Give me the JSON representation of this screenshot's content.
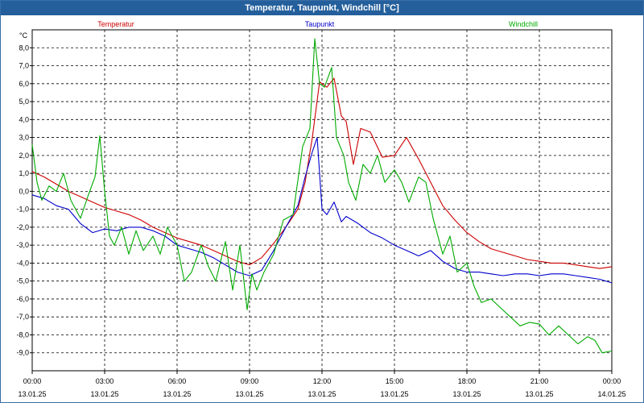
{
  "window": {
    "title": "Temperatur, Taupunkt, Windchill [°C]"
  },
  "chart_data": {
    "type": "line",
    "title": "Temperatur, Taupunkt, Windchill [°C]",
    "ylabel": "°C",
    "ylim": [
      -10,
      9
    ],
    "yticks": [
      "8,0",
      "7,0",
      "6,0",
      "5,0",
      "4,0",
      "3,0",
      "2,0",
      "1,0",
      "0,0",
      "-1,0",
      "-2,0",
      "-3,0",
      "-4,0",
      "-5,0",
      "-6,0",
      "-7,0",
      "-8,0",
      "-9,0"
    ],
    "ytick_values": [
      8,
      7,
      6,
      5,
      4,
      3,
      2,
      1,
      0,
      -1,
      -2,
      -3,
      -4,
      -5,
      -6,
      -7,
      -8,
      -9
    ],
    "xlim": [
      0,
      24
    ],
    "xticks": [
      {
        "time": "00:00",
        "date": "13.01.25",
        "x": 0
      },
      {
        "time": "03:00",
        "date": "13.01.25",
        "x": 3
      },
      {
        "time": "06:00",
        "date": "13.01.25",
        "x": 6
      },
      {
        "time": "09:00",
        "date": "13.01.25",
        "x": 9
      },
      {
        "time": "12:00",
        "date": "13.01.25",
        "x": 12
      },
      {
        "time": "15:00",
        "date": "13.01.25",
        "x": 15
      },
      {
        "time": "18:00",
        "date": "13.01.25",
        "x": 18
      },
      {
        "time": "21:00",
        "date": "13.01.25",
        "x": 21
      },
      {
        "time": "00:00",
        "date": "14.01.25",
        "x": 24
      }
    ],
    "grid": true,
    "legend_position": "top",
    "series": [
      {
        "name": "Temperatur",
        "color": "#cc0000",
        "x": [
          0,
          0.5,
          1,
          1.5,
          2,
          2.5,
          3,
          3.5,
          4,
          4.5,
          5,
          5.5,
          6,
          6.5,
          7,
          7.5,
          8,
          8.5,
          9,
          9.5,
          10,
          10.5,
          11,
          11.3,
          11.6,
          11.9,
          12.2,
          12.5,
          12.8,
          13,
          13.3,
          13.6,
          14,
          14.5,
          15,
          15.5,
          16,
          16.5,
          17,
          17.5,
          18,
          18.5,
          19,
          19.5,
          20,
          20.5,
          21,
          21.5,
          22,
          22.5,
          23,
          23.5,
          24
        ],
        "values": [
          1.1,
          0.8,
          0.4,
          0.0,
          -0.3,
          -0.6,
          -0.9,
          -1.1,
          -1.3,
          -1.6,
          -2.0,
          -2.3,
          -2.6,
          -2.8,
          -3.0,
          -3.3,
          -3.6,
          -3.9,
          -4.1,
          -3.7,
          -2.9,
          -2.0,
          -1.0,
          0.5,
          3.0,
          6.1,
          5.8,
          6.3,
          4.2,
          3.9,
          1.5,
          3.5,
          3.3,
          1.9,
          2.0,
          3.0,
          1.8,
          0.5,
          -0.8,
          -1.6,
          -2.3,
          -2.8,
          -3.2,
          -3.4,
          -3.6,
          -3.8,
          -3.9,
          -4.0,
          -4.0,
          -4.1,
          -4.2,
          -4.3,
          -4.2
        ]
      },
      {
        "name": "Taupunkt",
        "color": "#0000cc",
        "x": [
          0,
          0.5,
          1,
          1.5,
          2,
          2.5,
          3,
          3.5,
          4,
          4.5,
          5,
          5.5,
          6,
          6.5,
          7,
          7.5,
          8,
          8.5,
          9,
          9.5,
          10,
          10.5,
          11,
          11.3,
          11.6,
          11.8,
          12,
          12.2,
          12.5,
          12.8,
          13,
          13.5,
          14,
          14.5,
          15,
          15.5,
          16,
          16.5,
          17,
          17.5,
          18,
          18.5,
          19,
          19.5,
          20,
          20.5,
          21,
          21.5,
          22,
          22.5,
          23,
          23.5,
          24
        ],
        "values": [
          -0.2,
          -0.4,
          -0.8,
          -1.0,
          -1.8,
          -2.3,
          -2.1,
          -2.2,
          -2.0,
          -2.0,
          -2.2,
          -2.5,
          -3.0,
          -3.2,
          -3.4,
          -3.7,
          -4.1,
          -4.5,
          -4.7,
          -4.4,
          -3.3,
          -2.0,
          -0.8,
          0.8,
          2.2,
          3.0,
          -1.0,
          -1.3,
          -0.6,
          -1.7,
          -1.4,
          -1.8,
          -2.3,
          -2.6,
          -3.0,
          -3.3,
          -3.6,
          -3.3,
          -3.9,
          -4.3,
          -4.5,
          -4.5,
          -4.6,
          -4.7,
          -4.6,
          -4.6,
          -4.7,
          -4.6,
          -4.6,
          -4.7,
          -4.8,
          -4.9,
          -5.1
        ]
      },
      {
        "name": "Windchill",
        "color": "#00aa00",
        "x": [
          0,
          0.2,
          0.4,
          0.7,
          1,
          1.3,
          1.6,
          2,
          2.3,
          2.6,
          2.8,
          3,
          3.2,
          3.4,
          3.7,
          4,
          4.3,
          4.6,
          5,
          5.3,
          5.6,
          6,
          6.3,
          6.6,
          7,
          7.3,
          7.6,
          8,
          8.3,
          8.6,
          8.9,
          9.1,
          9.3,
          9.6,
          10,
          10.4,
          10.8,
          11.2,
          11.5,
          11.7,
          11.9,
          12.1,
          12.4,
          12.6,
          12.9,
          13.1,
          13.4,
          13.7,
          14,
          14.3,
          14.6,
          15,
          15.3,
          15.6,
          16,
          16.3,
          16.6,
          17,
          17.3,
          17.6,
          18,
          18.3,
          18.6,
          19,
          19.4,
          19.8,
          20.2,
          20.6,
          21,
          21.4,
          21.8,
          22.2,
          22.6,
          23,
          23.3,
          23.6,
          24
        ],
        "values": [
          2.6,
          0.5,
          -0.5,
          0.3,
          0.0,
          1.0,
          -0.5,
          -1.5,
          -0.3,
          0.8,
          3.1,
          0.0,
          -2.5,
          -3.0,
          -2.0,
          -3.5,
          -2.2,
          -3.3,
          -2.5,
          -3.5,
          -2.0,
          -3.0,
          -5.0,
          -4.5,
          -3.0,
          -4.2,
          -5.0,
          -2.8,
          -5.5,
          -3.0,
          -6.6,
          -4.6,
          -5.5,
          -4.5,
          -3.5,
          -1.6,
          -1.3,
          2.5,
          3.5,
          8.5,
          6.0,
          5.8,
          6.9,
          3.0,
          2.0,
          0.5,
          -0.5,
          1.5,
          1.0,
          2.0,
          0.5,
          1.2,
          0.5,
          -0.6,
          0.8,
          0.5,
          -1.5,
          -3.5,
          -2.5,
          -4.5,
          -4.0,
          -5.3,
          -6.2,
          -6.0,
          -6.5,
          -7.0,
          -7.5,
          -7.3,
          -7.4,
          -8.0,
          -7.5,
          -8.0,
          -8.5,
          -8.1,
          -8.3,
          -9.0,
          -8.9
        ]
      }
    ]
  }
}
